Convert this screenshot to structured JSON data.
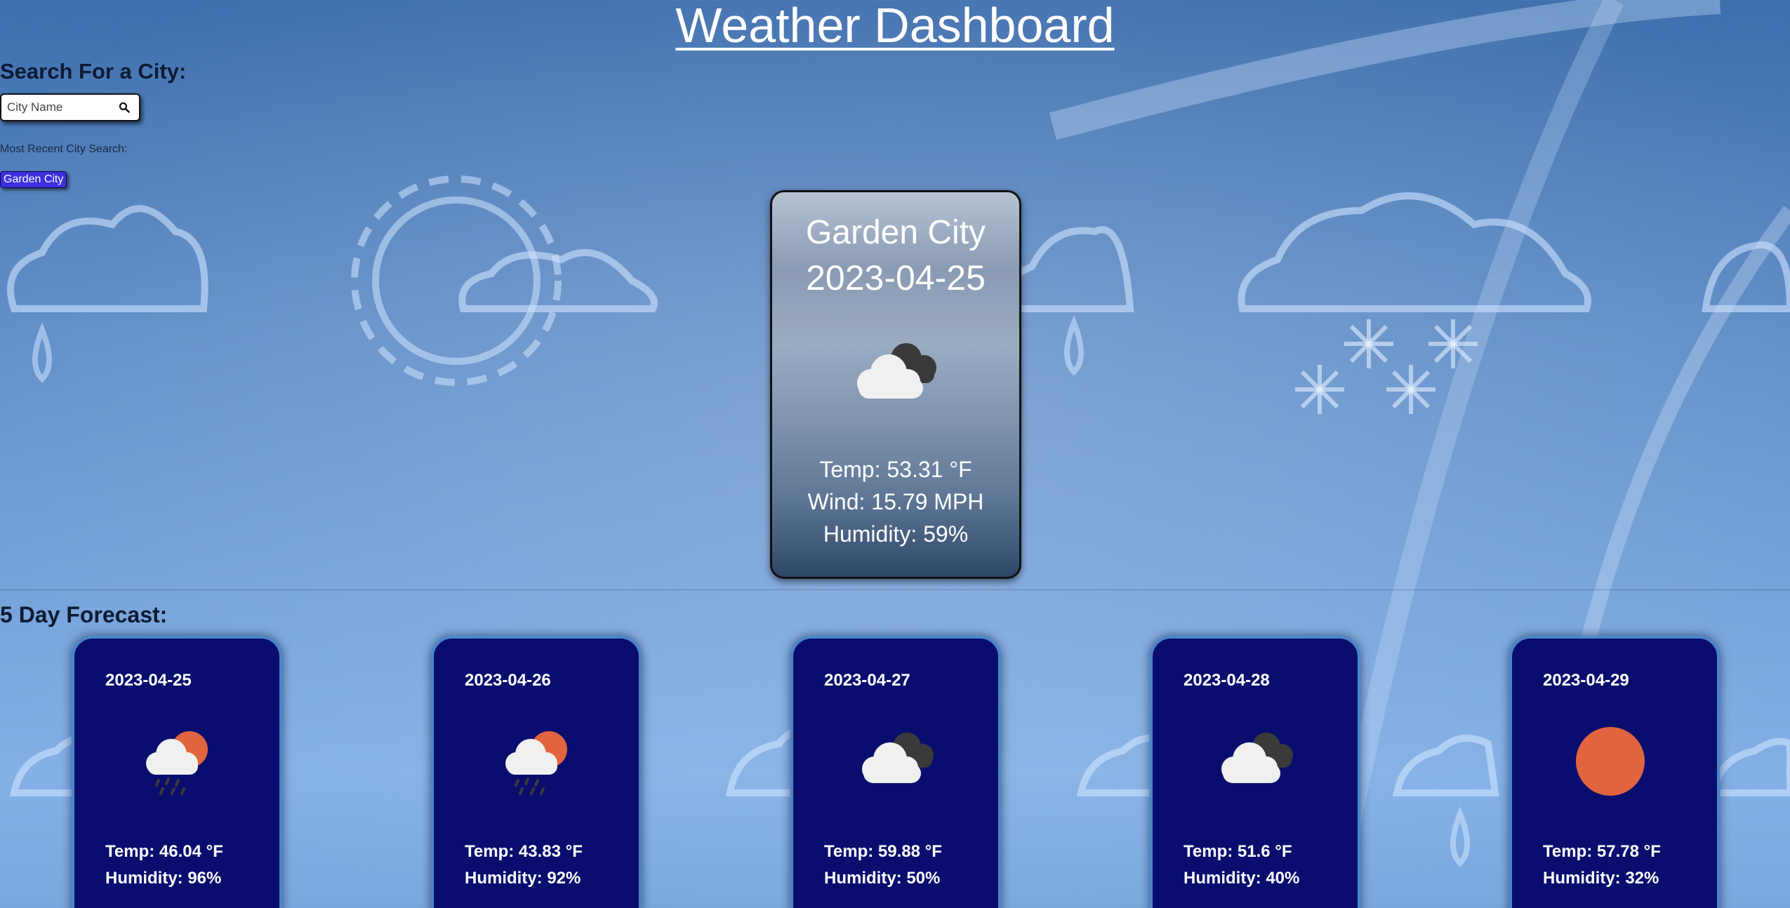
{
  "header": {
    "title": "Weather Dashboard"
  },
  "search": {
    "heading": "Search For a City:",
    "placeholder": "City Name",
    "value": "",
    "icon": "search-icon"
  },
  "recent": {
    "label": "Most Recent City Search:",
    "cities": [
      "Garden City"
    ]
  },
  "current": {
    "city": "Garden City",
    "date": "2023-04-25",
    "icon": "cloudy-icon",
    "temp": "Temp: 53.31 °F",
    "wind": "Wind: 15.79 MPH",
    "humidity": "Humidity: 59%"
  },
  "forecast": {
    "heading": "5 Day Forecast:",
    "days": [
      {
        "date": "2023-04-25",
        "icon": "rain-sun-icon",
        "temp": "Temp: 46.04 °F",
        "humidity": "Humidity: 96%"
      },
      {
        "date": "2023-04-26",
        "icon": "rain-sun-icon",
        "temp": "Temp: 43.83 °F",
        "humidity": "Humidity: 92%"
      },
      {
        "date": "2023-04-27",
        "icon": "cloudy-icon",
        "temp": "Temp: 59.88 °F",
        "humidity": "Humidity: 50%"
      },
      {
        "date": "2023-04-28",
        "icon": "cloudy-icon",
        "temp": "Temp: 51.6 °F",
        "humidity": "Humidity: 40%"
      },
      {
        "date": "2023-04-29",
        "icon": "sun-icon",
        "temp": "Temp: 57.78 °F",
        "humidity": "Humidity: 32%"
      }
    ]
  },
  "colors": {
    "forecast_card_bg": "#090e6e",
    "forecast_card_border": "#4a86c8",
    "recent_button_bg": "#3b2fe0",
    "sun": "#e2643f",
    "cloud_light": "#f0f0f0",
    "cloud_dark": "#3a3a3a"
  }
}
